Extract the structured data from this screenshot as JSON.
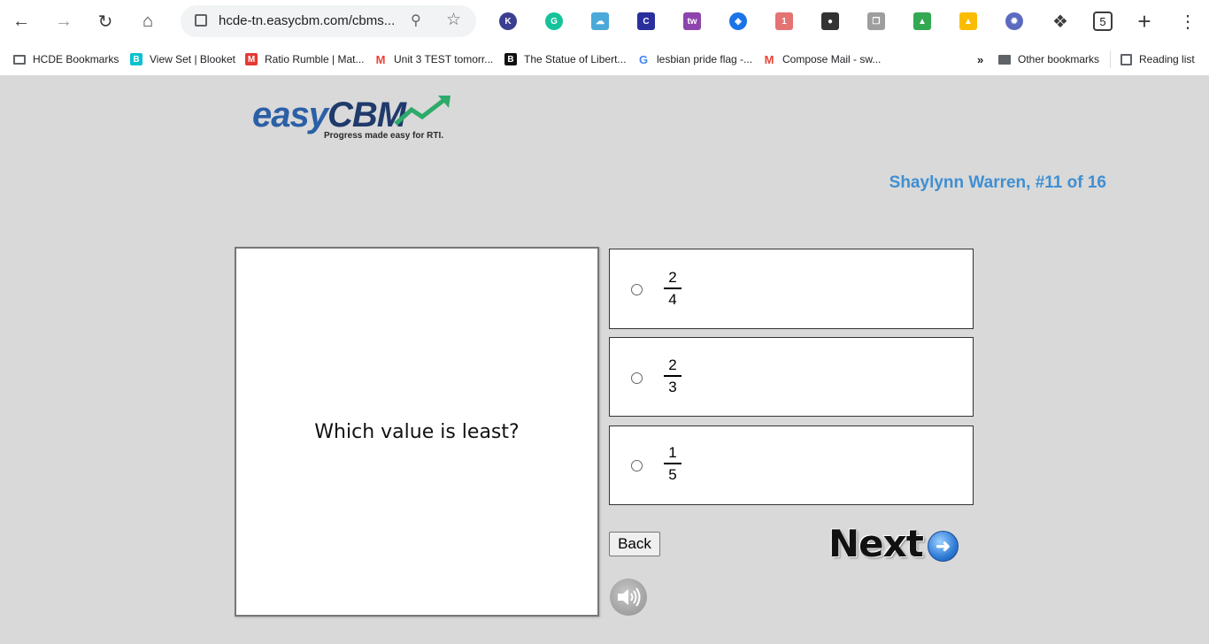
{
  "browser": {
    "url": "hcde-tn.easycbm.com/cbms...",
    "tab_count": "5",
    "bookmarks": [
      {
        "label": "HCDE Bookmarks",
        "icon": "folder-icon"
      },
      {
        "label": "View Set | Blooket",
        "icon": "blooket-icon"
      },
      {
        "label": "Ratio Rumble | Mat...",
        "icon": "mathletics-icon"
      },
      {
        "label": "Unit 3 TEST tomorr...",
        "icon": "gmail-icon"
      },
      {
        "label": "The Statue of Libert...",
        "icon": "brainpop-icon"
      },
      {
        "label": "lesbian pride flag -...",
        "icon": "google-icon"
      },
      {
        "label": "Compose Mail - sw...",
        "icon": "gmail-icon"
      }
    ],
    "other_bookmarks": "Other bookmarks",
    "reading_list": "Reading list"
  },
  "page": {
    "logo_easy": "easy",
    "logo_cbm": "CBM",
    "logo_tagline": "Progress made easy for RTI.",
    "student_progress": "Shaylynn Warren, #11 of 16",
    "question": "Which value is least?",
    "choices": [
      {
        "numerator": "2",
        "denominator": "4"
      },
      {
        "numerator": "2",
        "denominator": "3"
      },
      {
        "numerator": "1",
        "denominator": "5"
      }
    ],
    "back_label": "Back",
    "next_label": "Next"
  }
}
